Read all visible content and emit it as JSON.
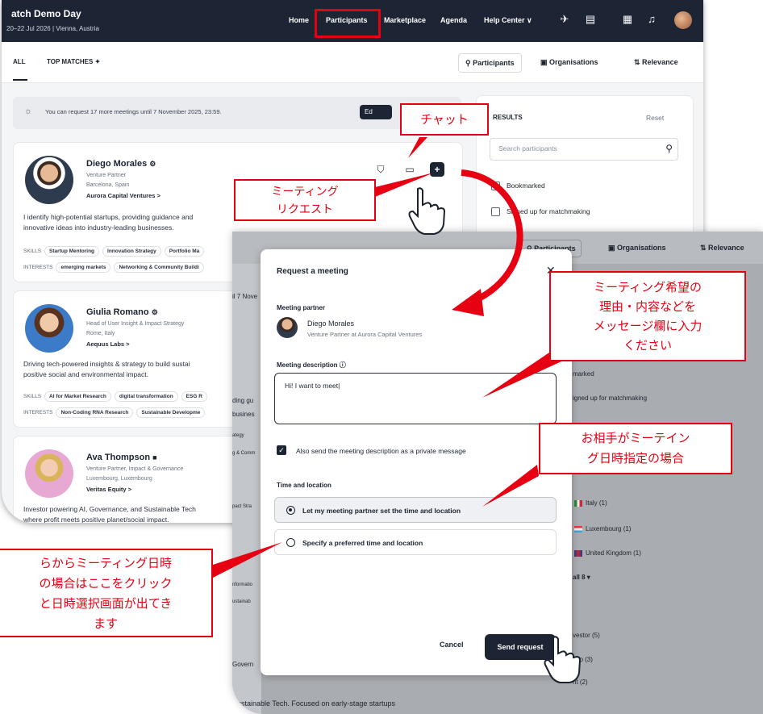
{
  "app": {
    "title": "atch Demo Day",
    "subtitle": "20–22 Jul 2026 | Vienna, Austria",
    "nav": [
      "Home",
      "Participants",
      "Marketplace",
      "Agenda",
      "Help Center ∨"
    ]
  },
  "subnav": {
    "tabs": [
      "ALL",
      "TOP MATCHES ✦"
    ],
    "participants_btn": "Participants",
    "organisations_btn": "Organisations",
    "relevance_btn": "Relevance"
  },
  "notice": {
    "text": "You can request 17 more meetings until 7 November 2025, 23:59.",
    "button": "Ed"
  },
  "cards": [
    {
      "name": "Diego Morales",
      "role": "Venture Partner",
      "location": "Barcelona, Spain",
      "org": "Aurora Capital Ventures  >",
      "bio1": "I identify high-potential startups, providing guidance and",
      "bio2": "innovative ideas into industry-leading businesses.",
      "skills_label": "SKILLS",
      "skills": [
        "Startup Mentoring",
        "Innovation Strategy",
        "Portfolio Ma"
      ],
      "interests_label": "INTERESTS",
      "interests": [
        "emerging markets",
        "Networking & Community Buildi"
      ]
    },
    {
      "name": "Giulia Romano",
      "role": "Head of User Insight & Impact Strategy",
      "location": "Rome, Italy",
      "org": "Aequus Labs  >",
      "bio1": "Driving tech-powered insights & strategy to build sustai",
      "bio2": "positive social and environmental impact.",
      "skills_label": "SKILLS",
      "skills": [
        "AI for Market Research",
        "digital transformation",
        "ESG R"
      ],
      "interests_label": "INTERESTS",
      "interests": [
        "Non-Coding RNA Research",
        "Sustainable Developme"
      ]
    },
    {
      "name": "Ava Thompson",
      "role": "Venture Partner, Impact & Governance",
      "location": "Luxembourg, Luxembourg",
      "org": "Veritas Equity  >",
      "bio1": "Investor powering AI, Governance, and Sustainable Tech",
      "bio2": "where profit meets positive planet/social impact."
    }
  ],
  "filters": {
    "title": "RESULTS",
    "reset": "Reset",
    "search_placeholder": "Search participants",
    "options": [
      "Bookmarked",
      "Signed up for matchmaking"
    ]
  },
  "overlay_bg": {
    "participants_btn": "Participants",
    "organisations_btn": "Organisations",
    "relevance_btn": "Relevance",
    "left_texts": [
      "il 7 Nove",
      "ding gu",
      "busines",
      "ategy",
      "g & Comm",
      "pact Stra",
      "nformatio",
      "ustainab",
      "Govern"
    ],
    "bottom_text": "Sustainable Tech. Focused on early-stage startups",
    "right_texts": [
      "marked",
      "igned up for matchmaking"
    ],
    "countries": [
      "Italy (1)",
      "Luxembourg (1)",
      "United Kingdom (1)"
    ],
    "show_all": "all 8 ▾",
    "types": [
      "vestor (5)",
      "-Up (3)",
      "nt (2)"
    ]
  },
  "modal": {
    "title": "Request a meeting",
    "close": "✕",
    "partner_label": "Meeting partner",
    "partner_name": "Diego Morales",
    "partner_role": "Venture Partner at Aurora Capital Ventures",
    "description_label": "Meeting description ⓘ",
    "description_value": "Hi! I want to meet|",
    "private_message_label": "Also send the meeting description as a private message",
    "time_location_label": "Time and location",
    "option_partner": "Let my meeting partner set the time and location",
    "option_preferred": "Specify a preferred time and location",
    "cancel": "Cancel",
    "send": "Send request"
  },
  "annotations": {
    "chat": "チャット",
    "meeting_request_1": "ミーティング",
    "meeting_request_2": "リクエスト",
    "message_hint_1": "ミーティング希望の",
    "message_hint_2": "理由・内容などを",
    "message_hint_3": "メッセージ欄に入力",
    "message_hint_4": "ください",
    "partner_time_1": "お相手がミーテイン",
    "partner_time_2": "グ日時指定の場合",
    "self_time_1": "らからミーティング日時",
    "self_time_2": "の場合はここをクリック",
    "self_time_3": "と日時選択画面が出てき",
    "self_time_4": "ます"
  },
  "colors": {
    "navy": "#1d2433",
    "annotation_red": "#e60012"
  }
}
